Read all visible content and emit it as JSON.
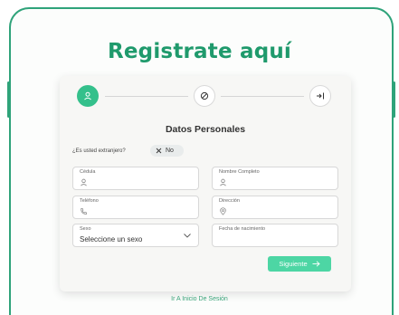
{
  "page": {
    "title": "Registrate aquí",
    "accent_color": "#1f9a6c",
    "button_color": "#4dd6a4"
  },
  "steps": [
    {
      "icon": "user-icon",
      "state": "active"
    },
    {
      "icon": "blocked-icon",
      "state": "idle"
    },
    {
      "icon": "login-arrow-icon",
      "state": "idle"
    }
  ],
  "form": {
    "section_title": "Datos Personales",
    "foreign_question": "¿Es usted extranjero?",
    "foreign_toggle_value": "No",
    "fields": {
      "cedula": {
        "label": "Cédula",
        "icon": "user-icon"
      },
      "nombre": {
        "label": "Nombre Completo",
        "icon": "user-icon"
      },
      "telefono": {
        "label": "Teléfono",
        "icon": "phone-icon"
      },
      "direccion": {
        "label": "Dirección",
        "icon": "location-pin-icon"
      },
      "sexo": {
        "label": "Sexo",
        "value": "Seleccione un sexo"
      },
      "fecha": {
        "label": "Fecha de nacimiento"
      }
    },
    "next_label": "Siguiente"
  },
  "footer": {
    "login_link": "Ir A Inicio De Sesión"
  }
}
